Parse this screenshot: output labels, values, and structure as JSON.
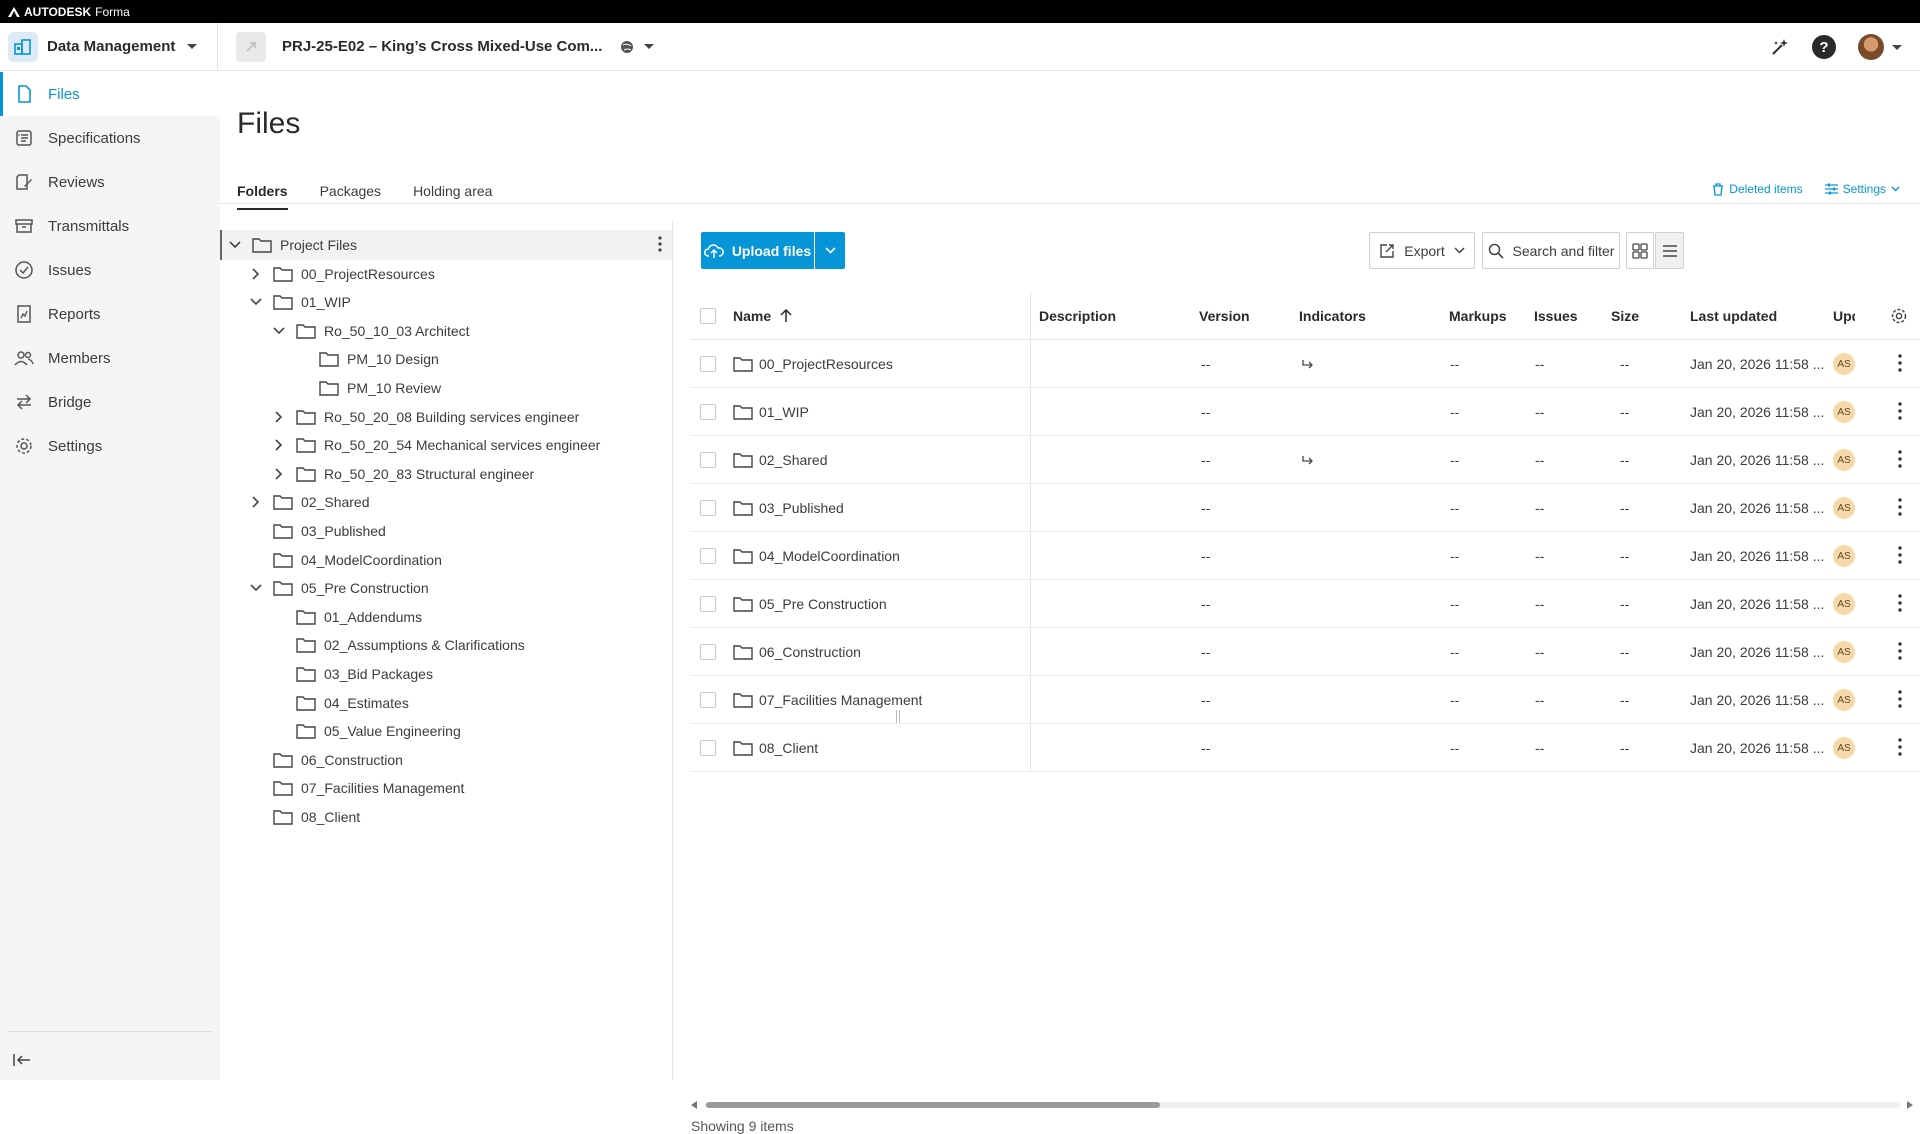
{
  "topbar": {
    "brand": "AUTODESK",
    "product": "Forma"
  },
  "header": {
    "app_name": "Data Management",
    "project_name": "PRJ-25-E02 – King’s Cross Mixed-Use Com..."
  },
  "sidebar": {
    "items": [
      {
        "label": "Files",
        "icon": "file-icon",
        "active": true
      },
      {
        "label": "Specifications",
        "icon": "specifications-icon",
        "active": false
      },
      {
        "label": "Reviews",
        "icon": "reviews-icon",
        "active": false
      },
      {
        "label": "Transmittals",
        "icon": "transmittals-icon",
        "active": false
      },
      {
        "label": "Issues",
        "icon": "issues-icon",
        "active": false
      },
      {
        "label": "Reports",
        "icon": "reports-icon",
        "active": false
      },
      {
        "label": "Members",
        "icon": "members-icon",
        "active": false
      },
      {
        "label": "Bridge",
        "icon": "bridge-icon",
        "active": false
      },
      {
        "label": "Settings",
        "icon": "gear-icon",
        "active": false
      }
    ]
  },
  "page": {
    "title": "Files",
    "tabs": [
      {
        "label": "Folders",
        "active": true
      },
      {
        "label": "Packages",
        "active": false
      },
      {
        "label": "Holding area",
        "active": false
      }
    ],
    "deleted_items": "Deleted items",
    "settings": "Settings"
  },
  "tree": [
    {
      "label": "Project Files",
      "level": 0,
      "expand": "open",
      "selected": true
    },
    {
      "label": "00_ProjectResources",
      "level": 1,
      "expand": "closed"
    },
    {
      "label": "01_WIP",
      "level": 1,
      "expand": "open"
    },
    {
      "label": "Ro_50_10_03 Architect",
      "level": 2,
      "expand": "open"
    },
    {
      "label": "PM_10 Design",
      "level": 3,
      "expand": "none"
    },
    {
      "label": "PM_10 Review",
      "level": 3,
      "expand": "none"
    },
    {
      "label": "Ro_50_20_08 Building services engineer",
      "level": 2,
      "expand": "closed"
    },
    {
      "label": "Ro_50_20_54 Mechanical services engineer",
      "level": 2,
      "expand": "closed"
    },
    {
      "label": "Ro_50_20_83 Structural engineer",
      "level": 2,
      "expand": "closed"
    },
    {
      "label": "02_Shared",
      "level": 1,
      "expand": "closed"
    },
    {
      "label": "03_Published",
      "level": 1,
      "expand": "none"
    },
    {
      "label": "04_ModelCoordination",
      "level": 1,
      "expand": "none"
    },
    {
      "label": "05_Pre Construction",
      "level": 1,
      "expand": "open"
    },
    {
      "label": "01_Addendums",
      "level": 2,
      "expand": "none"
    },
    {
      "label": "02_Assumptions & Clarifications",
      "level": 2,
      "expand": "none"
    },
    {
      "label": "03_Bid Packages",
      "level": 2,
      "expand": "none"
    },
    {
      "label": "04_Estimates",
      "level": 2,
      "expand": "none"
    },
    {
      "label": "05_Value Engineering",
      "level": 2,
      "expand": "none"
    },
    {
      "label": "06_Construction",
      "level": 1,
      "expand": "none"
    },
    {
      "label": "07_Facilities Management",
      "level": 1,
      "expand": "none"
    },
    {
      "label": "08_Client",
      "level": 1,
      "expand": "none"
    }
  ],
  "toolbar": {
    "upload": "Upload files",
    "export": "Export",
    "search": "Search and filter"
  },
  "table": {
    "columns": [
      "Name",
      "Description",
      "Version",
      "Indicators",
      "Markups",
      "Issues",
      "Size",
      "Last updated",
      "Upd"
    ],
    "rows": [
      {
        "name": "00_ProjectResources",
        "description": "",
        "version": "--",
        "indicator": true,
        "markups": "--",
        "issues": "--",
        "size": "--",
        "updated": "Jan 20, 2026 11:58 ...",
        "by": "AS"
      },
      {
        "name": "01_WIP",
        "description": "",
        "version": "--",
        "indicator": false,
        "markups": "--",
        "issues": "--",
        "size": "--",
        "updated": "Jan 20, 2026 11:58 ...",
        "by": "AS"
      },
      {
        "name": "02_Shared",
        "description": "",
        "version": "--",
        "indicator": true,
        "markups": "--",
        "issues": "--",
        "size": "--",
        "updated": "Jan 20, 2026 11:58 ...",
        "by": "AS"
      },
      {
        "name": "03_Published",
        "description": "",
        "version": "--",
        "indicator": false,
        "markups": "--",
        "issues": "--",
        "size": "--",
        "updated": "Jan 20, 2026 11:58 ...",
        "by": "AS"
      },
      {
        "name": "04_ModelCoordination",
        "description": "",
        "version": "--",
        "indicator": false,
        "markups": "--",
        "issues": "--",
        "size": "--",
        "updated": "Jan 20, 2026 11:58 ...",
        "by": "AS"
      },
      {
        "name": "05_Pre Construction",
        "description": "",
        "version": "--",
        "indicator": false,
        "markups": "--",
        "issues": "--",
        "size": "--",
        "updated": "Jan 20, 2026 11:58 ...",
        "by": "AS"
      },
      {
        "name": "06_Construction",
        "description": "",
        "version": "--",
        "indicator": false,
        "markups": "--",
        "issues": "--",
        "size": "--",
        "updated": "Jan 20, 2026 11:58 ...",
        "by": "AS"
      },
      {
        "name": "07_Facilities Management",
        "description": "",
        "version": "--",
        "indicator": false,
        "markups": "--",
        "issues": "--",
        "size": "--",
        "updated": "Jan 20, 2026 11:58 ...",
        "by": "AS"
      },
      {
        "name": "08_Client",
        "description": "",
        "version": "--",
        "indicator": false,
        "markups": "--",
        "issues": "--",
        "size": "--",
        "updated": "Jan 20, 2026 11:58 ...",
        "by": "AS"
      }
    ]
  },
  "footer": {
    "count": "Showing 9 items"
  },
  "colors": {
    "accent": "#0696d7",
    "badge": "#f6d9a8",
    "topbar": "#000000"
  }
}
